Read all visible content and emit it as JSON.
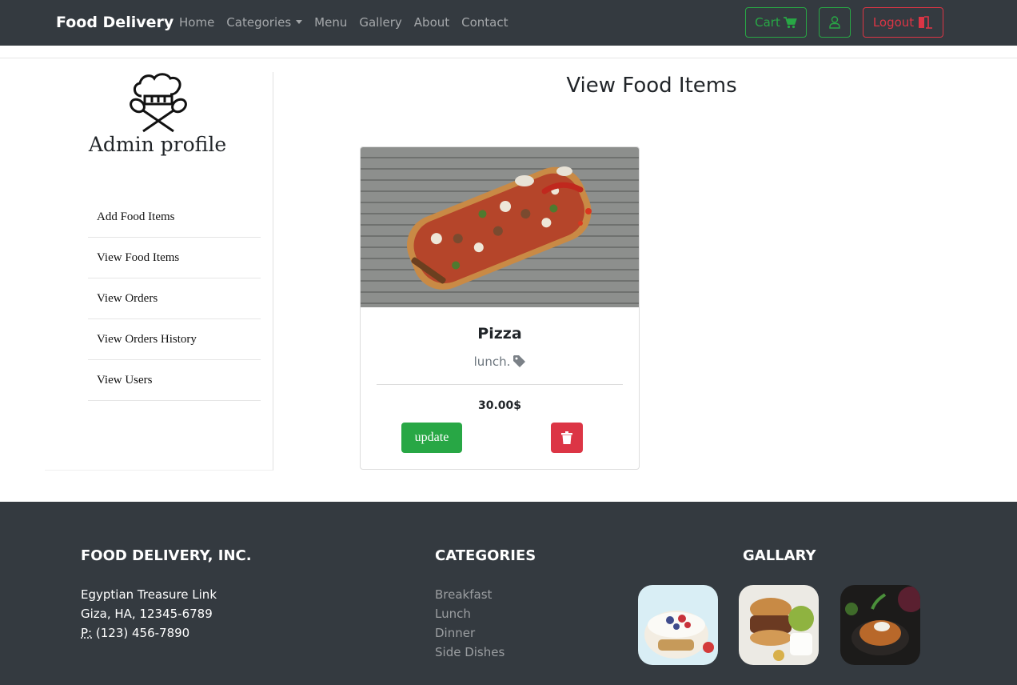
{
  "navbar": {
    "brand": "Food Delivery",
    "links": [
      "Home",
      "Categories",
      "Menu",
      "Gallery",
      "About",
      "Contact"
    ],
    "cart_label": "Cart",
    "logout_label": "Logout"
  },
  "sidebar": {
    "title": "Admin profile",
    "items": [
      "Add Food Items",
      "View Food Items",
      "View Orders",
      "View Orders History",
      "View Users"
    ]
  },
  "main": {
    "title": "View Food Items",
    "card": {
      "name": "Pizza",
      "category": "lunch.",
      "price": "30.00$",
      "update_label": "update"
    }
  },
  "footer": {
    "company": {
      "heading": "FOOD DELIVERY, INC.",
      "street": "Egyptian Treasure Link",
      "city": "Giza, HA, 12345-6789",
      "phone_label": "P:",
      "phone": "(123) 456-7890"
    },
    "categories": {
      "heading": "CATEGORIES",
      "items": [
        "Breakfast",
        "Lunch",
        "Dinner",
        "Side Dishes"
      ]
    },
    "gallery": {
      "heading": "GALLARY"
    }
  },
  "colors": {
    "navbar_bg": "#343a40",
    "success": "#28a745",
    "danger": "#dc3545"
  }
}
